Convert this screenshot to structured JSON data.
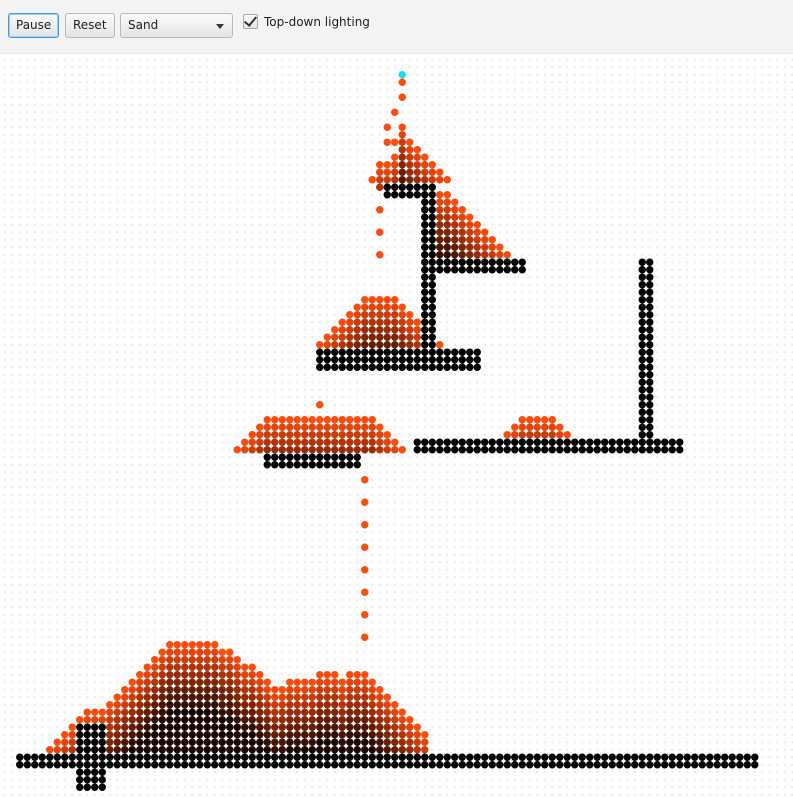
{
  "toolbar": {
    "pause_label": "Pause",
    "reset_label": "Reset",
    "material_selected": "Sand",
    "lighting_label": "Top-down lighting",
    "lighting_checked": true
  },
  "colors": {
    "sand_light": "#ff4a0a",
    "sand_dark": "#1a0600",
    "wall": "#000000",
    "emitter": "#14e0f0",
    "grid_dot": "#ededed"
  }
}
